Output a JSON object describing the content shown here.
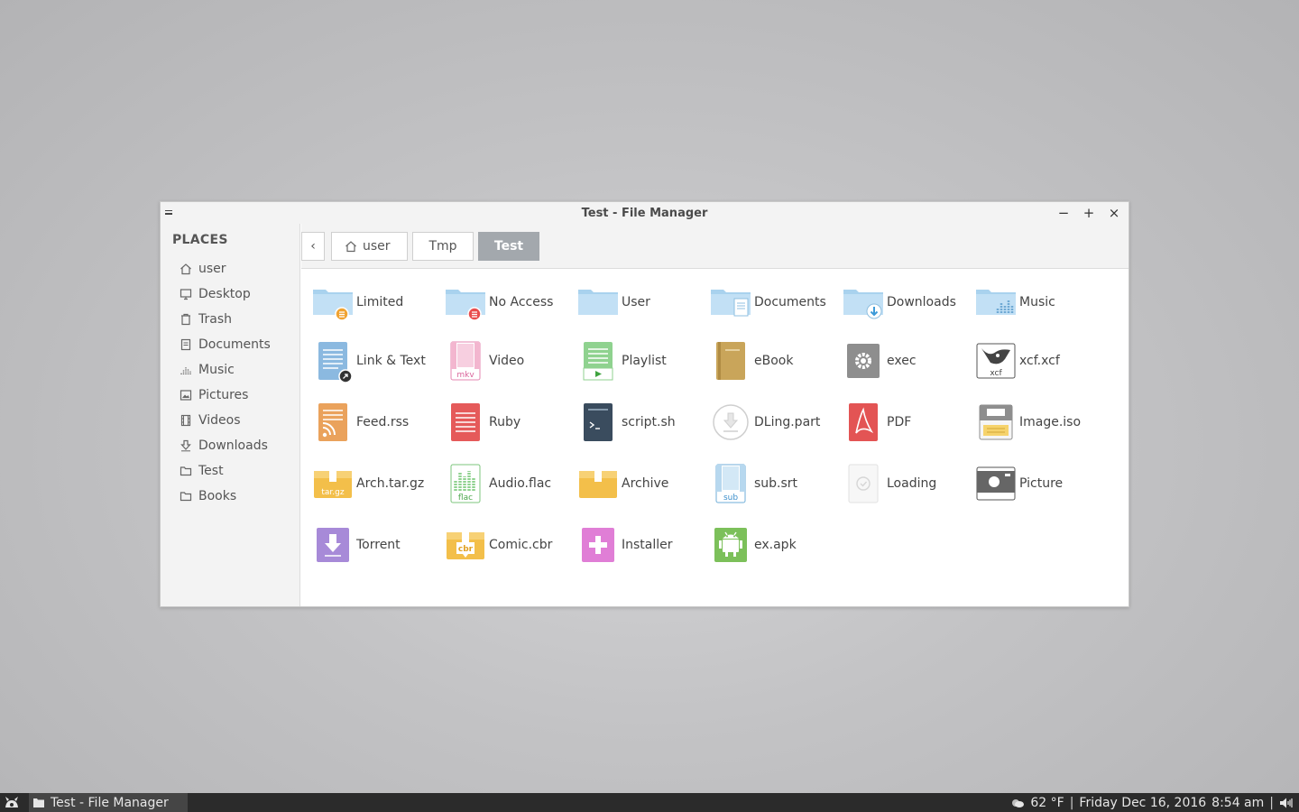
{
  "window": {
    "title": "Test - File Manager",
    "minimize": "−",
    "maximize": "+",
    "close": "×"
  },
  "sidebar": {
    "heading": "PLACES",
    "items": [
      {
        "label": "user",
        "icon": "home-icon"
      },
      {
        "label": "Desktop",
        "icon": "desktop-icon"
      },
      {
        "label": "Trash",
        "icon": "trash-icon"
      },
      {
        "label": "Documents",
        "icon": "document-icon"
      },
      {
        "label": "Music",
        "icon": "music-icon"
      },
      {
        "label": "Pictures",
        "icon": "picture-icon"
      },
      {
        "label": "Videos",
        "icon": "video-icon"
      },
      {
        "label": "Downloads",
        "icon": "download-icon"
      },
      {
        "label": "Test",
        "icon": "folder-icon"
      },
      {
        "label": "Books",
        "icon": "folder-icon"
      }
    ]
  },
  "toolbar": {
    "back": "‹",
    "crumbs": [
      "user",
      "Tmp",
      "Test"
    ]
  },
  "files": [
    {
      "label": "Limited",
      "icon": "folder-limited-icon"
    },
    {
      "label": "No Access",
      "icon": "folder-noaccess-icon"
    },
    {
      "label": "User",
      "icon": "folder-icon"
    },
    {
      "label": "Documents",
      "icon": "folder-documents-icon"
    },
    {
      "label": "Downloads",
      "icon": "folder-downloads-icon"
    },
    {
      "label": "Music",
      "icon": "folder-music-icon"
    },
    {
      "label": "Link & Text",
      "icon": "text-link-icon"
    },
    {
      "label": "Video",
      "icon": "video-mkv-icon"
    },
    {
      "label": "Playlist",
      "icon": "playlist-icon"
    },
    {
      "label": "eBook",
      "icon": "ebook-icon"
    },
    {
      "label": "exec",
      "icon": "executable-gear-icon"
    },
    {
      "label": "xcf.xcf",
      "icon": "xcf-image-icon"
    },
    {
      "label": "Feed.rss",
      "icon": "rss-feed-icon"
    },
    {
      "label": "Ruby",
      "icon": "ruby-script-icon"
    },
    {
      "label": "script.sh",
      "icon": "shell-script-icon"
    },
    {
      "label": "DLing.part",
      "icon": "partial-download-icon"
    },
    {
      "label": "PDF",
      "icon": "pdf-icon"
    },
    {
      "label": "Image.iso",
      "icon": "disc-image-icon"
    },
    {
      "label": "Arch.tar.gz",
      "icon": "tar-archive-icon"
    },
    {
      "label": "Audio.flac",
      "icon": "flac-audio-icon"
    },
    {
      "label": "Archive",
      "icon": "archive-box-icon"
    },
    {
      "label": "sub.srt",
      "icon": "subtitle-icon"
    },
    {
      "label": "Loading",
      "icon": "loading-icon"
    },
    {
      "label": "Picture",
      "icon": "camera-picture-icon"
    },
    {
      "label": "Torrent",
      "icon": "torrent-icon"
    },
    {
      "label": "Comic.cbr",
      "icon": "comic-archive-icon"
    },
    {
      "label": "Installer",
      "icon": "installer-icon"
    },
    {
      "label": "ex.apk",
      "icon": "android-apk-icon"
    }
  ],
  "icon_text": {
    "mkv": "mkv",
    "xcf": "xcf",
    "targz": "tar.gz",
    "flac": "flac",
    "sub": "sub",
    "cbr": "cbr"
  },
  "taskbar": {
    "task": "Test - File Manager",
    "weather": "62 °F",
    "separator": "|",
    "date": "Friday Dec 16, 2016",
    "time": "8:54 am"
  }
}
